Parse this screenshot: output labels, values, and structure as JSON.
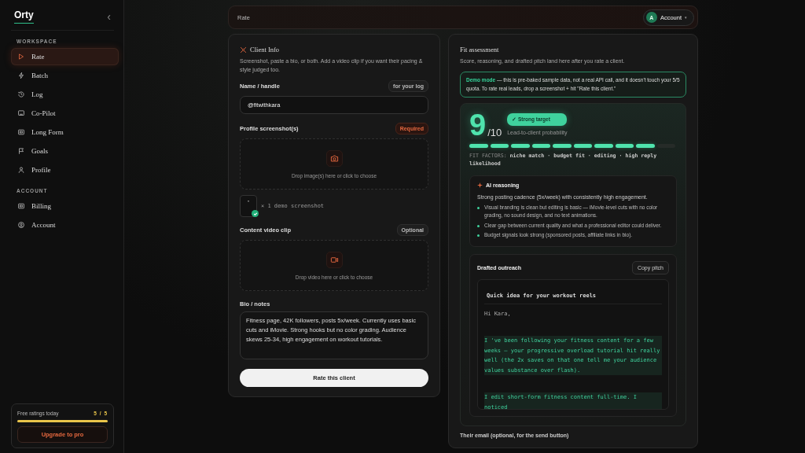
{
  "sidebar": {
    "brand": "Orty",
    "collapse_icon": "‹",
    "sections": [
      {
        "title": "WORKSPACE",
        "items": [
          {
            "label": "Rate",
            "selected": true
          },
          {
            "label": "Batch",
            "selected": false
          },
          {
            "label": "Log",
            "selected": false
          },
          {
            "label": "Co-Pilot",
            "selected": false
          },
          {
            "label": "Long Form",
            "selected": false
          },
          {
            "label": "Goals",
            "selected": false
          },
          {
            "label": "Profile",
            "selected": false
          }
        ]
      },
      {
        "title": "ACCOUNT",
        "items": [
          {
            "label": "Billing",
            "selected": false
          },
          {
            "label": "Account",
            "selected": false
          }
        ]
      }
    ],
    "quota": {
      "label": "Free ratings today",
      "count": "5 / 5",
      "level": 1,
      "button": "Upgrade to pro"
    }
  },
  "topbar": {
    "title": "Rate",
    "account": {
      "initial": "A",
      "label": "Account",
      "caret": "▾"
    }
  },
  "client_info": {
    "title": "Client Info",
    "description": "Screenshot, paste a bio, or both. Add a video clip if you want their pacing & style judged too.",
    "name_field": {
      "label": "Name / handle",
      "badge": "for your log",
      "value": "@fitwithkara"
    },
    "screenshot": {
      "label": "Profile screenshot(s)",
      "badge": "Required",
      "drop_text": "Drop image(s) here or click to choose",
      "thumb_text": "\"",
      "thumb_caption": "× 1 demo screenshot"
    },
    "video": {
      "label": "Content video clip",
      "badge": "Optional",
      "drop_text": "Drop video here or click to choose"
    },
    "bio": {
      "label": "Bio / notes",
      "value": "Fitness page, 42K followers, posts 5x/week. Currently uses basic cuts and iMovie. Strong hooks but no color grading. Audience skews 25-34, high engagement on workout tutorials."
    },
    "submit": "Rate this client"
  },
  "fit": {
    "title": "Fit assessment",
    "description": "Score, reasoning, and drafted pitch land here after you rate a client.",
    "demo_note": "**Demo mode** — this is pre-baked sample data, not a real API call, and it doesn't touch your 5/5 quota. To rate real leads, drop a screenshot + hit \"Rate this client.\"",
    "score": "9",
    "score_max": "/10",
    "verdict": "✓ Strong target",
    "probability_label": "Lead-to-client probability",
    "level": 0.9,
    "factors": "FIT FACTORS: **niche match · budget fit · editing · high reply likelihood**",
    "reasoning": {
      "title": "AI reasoning",
      "summary": "Strong posting cadence (5x/week) with consistently high engagement.",
      "points": [
        "Visual branding is clean but editing is basic — iMovie-level cuts with no color grading, no sound design, and no text animations.",
        "Clear gap between current quality and what a professional editor could deliver.",
        "Budget signals look strong (sponsored posts, affiliate links in bio)."
      ]
    },
    "outreach": {
      "title": "Drafted outreach",
      "copy_button": "Copy pitch",
      "subject": "Quick idea for your workout reels",
      "paragraphs": [
        {
          "text": "Hi Kara,",
          "highlighted": false
        },
        {
          "text": "I 've been following your fitness content for a few weeks — your progressive overload tutorial hit really well (the  2x saves on that one tell me your audience values substance over flash).",
          "highlighted": true
        },
        {
          "text": "I edit short-form fitness content full-time. I noticed",
          "highlighted": true
        }
      ]
    }
  },
  "email_label": "Their email (optional, for the send button)"
}
